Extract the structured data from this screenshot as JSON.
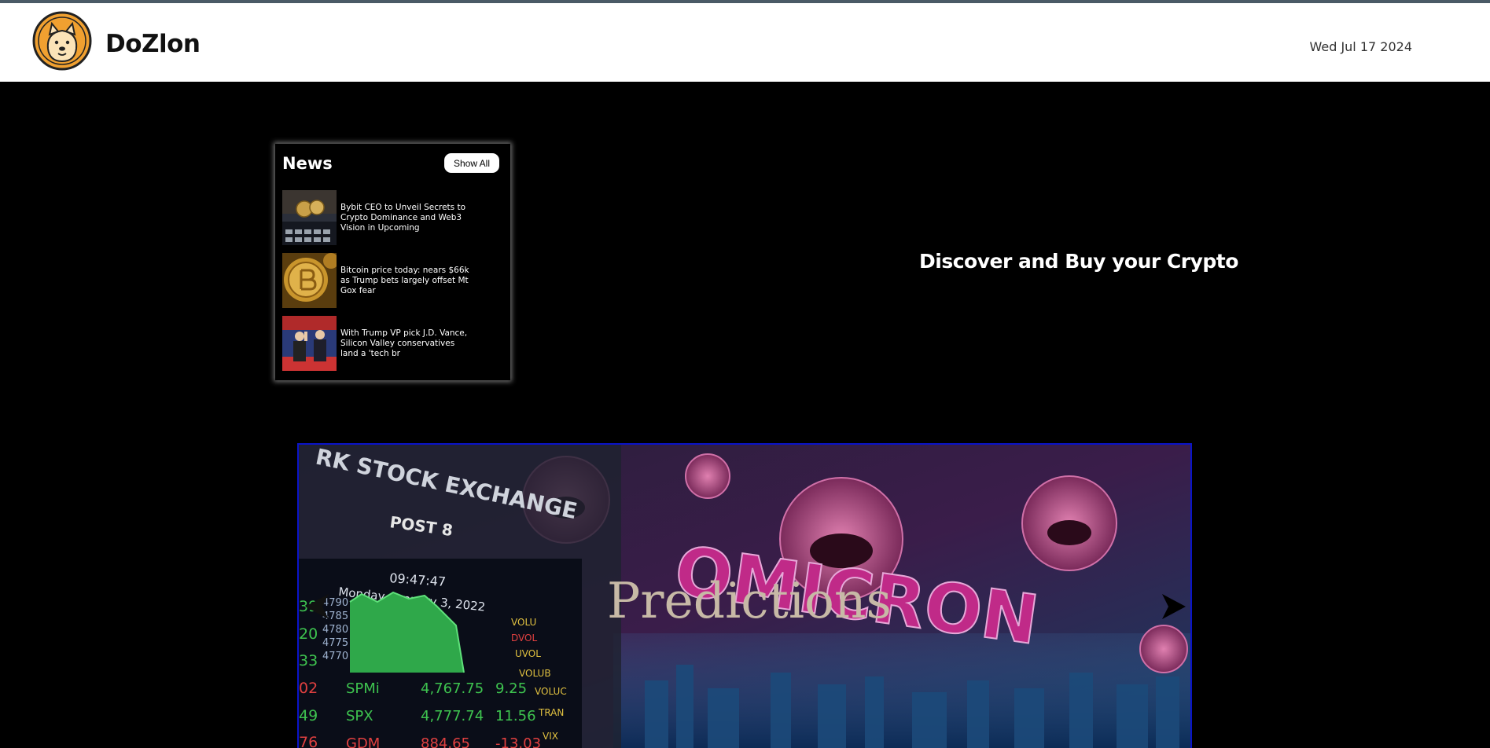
{
  "header": {
    "brand": "DoZlon",
    "date": "Wed Jul 17 2024"
  },
  "news": {
    "title": "News",
    "show_all_label": "Show All",
    "items": [
      {
        "headline": "Bybit CEO to Unveil Secrets to Crypto Dominance and Web3 Vision in Upcoming"
      },
      {
        "headline": "Bitcoin price today: nears $66k as Trump bets largely offset Mt Gox fear"
      },
      {
        "headline": "With Trump VP pick J.D. Vance, Silicon Valley conservatives land a 'tech br"
      }
    ]
  },
  "hero": {
    "tagline": "Discover and Buy your Crypto"
  },
  "carousel": {
    "caption": "Predictions",
    "image_text": {
      "exchange": "RK STOCK EXCHANGE",
      "post": "POST 8",
      "time": "09:47:47",
      "date": "Monday, January 3, 2022",
      "headline": "OMICRON",
      "ticker_rows": [
        [
          "SPMi",
          "4,767.75",
          "9.25"
        ],
        [
          "SPX",
          "4,777.74",
          "11.56"
        ],
        [
          "GDM",
          "884.65",
          "-13.03"
        ]
      ],
      "axis_values": [
        "4790",
        "4785",
        "4780",
        "4775",
        "4770"
      ],
      "row_prefixes": [
        "39",
        "20",
        "33",
        "02",
        "49",
        "76"
      ],
      "tickers": [
        "VOLU",
        "DVOL",
        "UVOL",
        "VOLUB",
        "VOLUC",
        "TRAN",
        "VIX"
      ]
    }
  },
  "colors": {
    "header_bg": "#ffffff",
    "page_bg": "#000000",
    "carousel_border": "#0a14c8",
    "logo_orange": "#f0a030"
  }
}
